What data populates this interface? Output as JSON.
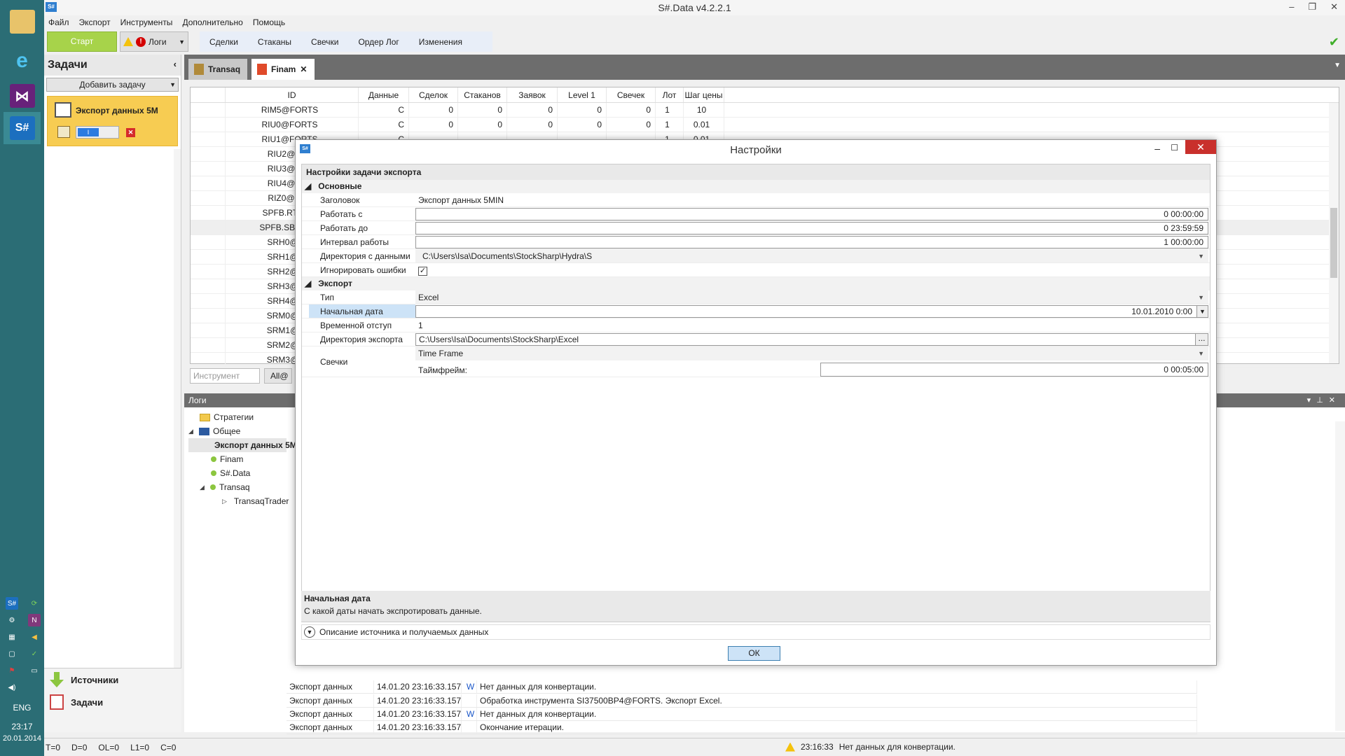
{
  "taskbar": {
    "lang": "ENG",
    "time": "23:17",
    "date": "20.01.2014",
    "apps": [
      "explorer-icon",
      "internet-explorer-icon",
      "visual-studio-icon",
      "stocksharp-icon"
    ]
  },
  "window": {
    "title": "S#.Data v4.2.2.1"
  },
  "menu": [
    "Файл",
    "Экспорт",
    "Инструменты",
    "Дополнительно",
    "Помощь"
  ],
  "toolbar": {
    "start": "Старт",
    "logs": "Логи",
    "views": [
      "Сделки",
      "Стаканы",
      "Свечки",
      "Ордер Лог",
      "Изменения"
    ]
  },
  "left_panel": {
    "title": "Задачи",
    "add_task": "Добавить задачу",
    "task_name": "Экспорт данных 5MIN",
    "toggle_label": "I",
    "nav_sources": "Источники",
    "nav_tasks": "Задачи"
  },
  "tabs": [
    "Transaq",
    "Finam"
  ],
  "grid": {
    "columns": [
      "ID",
      "Данные",
      "Сделок",
      "Стаканов",
      "Заявок",
      "Level 1",
      "Свечек",
      "Лот",
      "Шаг цены"
    ],
    "rows": [
      [
        "RIM5@FORTS",
        "C",
        "0",
        "0",
        "0",
        "0",
        "0",
        "1",
        "10"
      ],
      [
        "RIU0@FORTS",
        "C",
        "0",
        "0",
        "0",
        "0",
        "0",
        "1",
        "0.01"
      ],
      [
        "RIU1@FORTS",
        "C",
        "",
        "",
        "",
        "",
        "",
        "1",
        "0.01"
      ],
      [
        "RIU2@FOF",
        "",
        "",
        "",
        "",
        "",
        "",
        "",
        ""
      ],
      [
        "RIU3@FOF",
        "",
        "",
        "",
        "",
        "",
        "",
        "",
        ""
      ],
      [
        "RIU4@FOF",
        "",
        "",
        "",
        "",
        "",
        "",
        "",
        ""
      ],
      [
        "RIZ0@FOF",
        "",
        "",
        "",
        "",
        "",
        "",
        "",
        ""
      ],
      [
        "SPFB.RTS@F",
        "",
        "",
        "",
        "",
        "",
        "",
        "",
        ""
      ],
      [
        "SPFB.SBRF@F",
        "",
        "",
        "",
        "",
        "",
        "",
        "",
        ""
      ],
      [
        "SRH0@FOI",
        "",
        "",
        "",
        "",
        "",
        "",
        "",
        ""
      ],
      [
        "SRH1@FOI",
        "",
        "",
        "",
        "",
        "",
        "",
        "",
        ""
      ],
      [
        "SRH2@FOI",
        "",
        "",
        "",
        "",
        "",
        "",
        "",
        ""
      ],
      [
        "SRH3@FOI",
        "",
        "",
        "",
        "",
        "",
        "",
        "",
        ""
      ],
      [
        "SRH4@FOI",
        "",
        "",
        "",
        "",
        "",
        "",
        "",
        ""
      ],
      [
        "SRM0@FOI",
        "",
        "",
        "",
        "",
        "",
        "",
        "",
        ""
      ],
      [
        "SRM1@FOI",
        "",
        "",
        "",
        "",
        "",
        "",
        "",
        ""
      ],
      [
        "SRM2@FOI",
        "",
        "",
        "",
        "",
        "",
        "",
        "",
        ""
      ],
      [
        "SRM3@FOI",
        "",
        "",
        "",
        "",
        "",
        "",
        "",
        ""
      ]
    ],
    "filter_placeholder": "Инструмент",
    "all_button": "All@"
  },
  "logs": {
    "title": "Логи",
    "tree": [
      {
        "label": "Стратегии",
        "kind": "folder",
        "indent": 1
      },
      {
        "label": "Общее",
        "kind": "monitor",
        "indent": 0
      },
      {
        "label": "Экспорт данных 5MIN",
        "kind": "dot",
        "indent": 2
      },
      {
        "label": "Finam",
        "kind": "dot",
        "indent": 2
      },
      {
        "label": "S#.Data",
        "kind": "dot",
        "indent": 2
      },
      {
        "label": "Transaq",
        "kind": "dot",
        "indent": 1
      },
      {
        "label": "TransaqTrader",
        "kind": "dot",
        "indent": 3
      }
    ],
    "rows": [
      {
        "source": "Экспорт данных",
        "time": "14.01.20 23:16:33.157",
        "level": "W",
        "message": "Нет данных для конвертации."
      },
      {
        "source": "Экспорт данных",
        "time": "14.01.20 23:16:33.157",
        "level": "",
        "message": "Обработка инструмента SI37500BP4@FORTS. Экспорт Excel."
      },
      {
        "source": "Экспорт данных",
        "time": "14.01.20 23:16:33.157",
        "level": "W",
        "message": "Нет данных для конвертации."
      },
      {
        "source": "Экспорт данных",
        "time": "14.01.20 23:16:33.157",
        "level": "",
        "message": "Окончание итерации."
      }
    ]
  },
  "statusbar": {
    "counters": [
      "T=0",
      "D=0",
      "OL=0",
      "L1=0",
      "C=0"
    ],
    "time": "23:16:33",
    "message": "Нет данных для конвертации."
  },
  "dialog": {
    "title": "Настройки",
    "header": "Настройки задачи экспорта",
    "cat_main": "Основные",
    "cat_export": "Экспорт",
    "props": {
      "title_lbl": "Заголовок",
      "title_val": "Экспорт данных 5MIN",
      "from_lbl": "Работать с",
      "from_val": "0 00:00:00",
      "to_lbl": "Работать до",
      "to_val": "0 23:59:59",
      "interval_lbl": "Интервал работы",
      "interval_val": "1 00:00:00",
      "dir_lbl": "Директория с данными",
      "dir_val": "C:\\Users\\Isa\\Documents\\StockSharp\\Hydra\\S",
      "ignore_lbl": "Игнорировать ошибки",
      "type_lbl": "Тип",
      "type_val": "Excel",
      "start_lbl": "Начальная дата",
      "start_val": "10.01.2010 0:00",
      "offset_lbl": "Временной отступ",
      "offset_val": "1",
      "exportdir_lbl": "Директория экспорта",
      "exportdir_val": "C:\\Users\\Isa\\Documents\\StockSharp\\Excel",
      "candles_lbl": "Свечки",
      "candles_type": "Time Frame",
      "tf_lbl": "Таймфрейм:",
      "tf_val": "0 00:05:00"
    },
    "desc_title": "Начальная дата",
    "desc_text": "С какой даты начать экспротировать данные.",
    "expander": "Описание источника и получаемых данных",
    "ok": "ОК"
  }
}
